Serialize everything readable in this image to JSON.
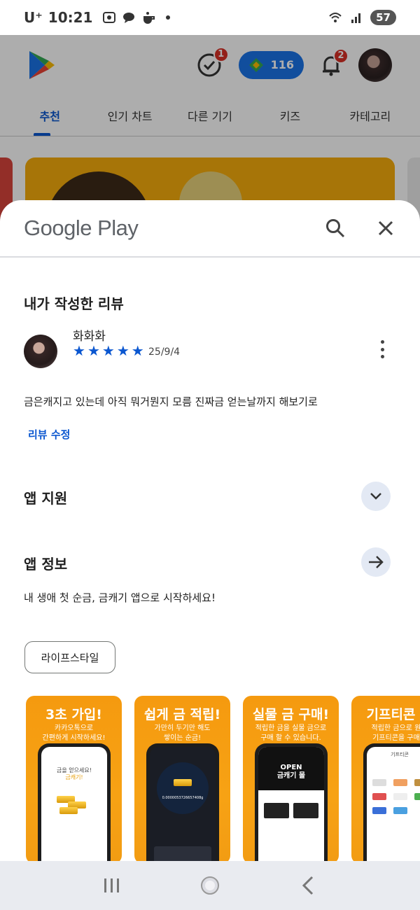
{
  "status_bar": {
    "carrier": "U⁺",
    "time": "10:21",
    "battery": "57",
    "icons": [
      "screenshot-icon",
      "talk-icon",
      "coffee-icon",
      "dot-icon",
      "wifi-icon",
      "signal-icon"
    ]
  },
  "background_app": {
    "badges": {
      "check": "1",
      "notifications": "2"
    },
    "points": "116",
    "tabs": [
      "추천",
      "인기 차트",
      "다른 기기",
      "키즈",
      "카테고리"
    ],
    "active_tab": 0
  },
  "sheet": {
    "logo": "Google Play",
    "reviews": {
      "title": "내가 작성한 리뷰",
      "reviewer": "화화화",
      "rating": 5,
      "stars": [
        "★",
        "★",
        "★",
        "★",
        "★"
      ],
      "date": "25/9/4",
      "text": "금은캐지고 있는데 아직 뭐거뭔지 모름 진짜금 얻는날까지 해보기로",
      "edit_label": "리뷰 수정"
    },
    "support": {
      "title": "앱 지원"
    },
    "about": {
      "title": "앱 정보",
      "description": "내 생애 첫 순금, 금캐기 앱으로 시작하세요!",
      "category": "라이프스타일"
    },
    "screenshots": [
      {
        "title": "3초 가입!",
        "subtitle": [
          "카카오톡으로",
          "간편하게 시작하세요!"
        ],
        "screen_text": [
          "금을 얻으세요!",
          "금캐기!"
        ]
      },
      {
        "title": "쉽게 금 적립!",
        "subtitle": [
          "가만히 두기만 해도",
          "쌓이는 순금!"
        ],
        "screen_text": [
          "0.0000053726657408g"
        ]
      },
      {
        "title": "실물 금 구매!",
        "subtitle": [
          "적립한 금을 실물 금으로",
          "구매 할 수 있습니다."
        ],
        "screen_text": [
          "OPEN",
          "금캐기 몰"
        ]
      },
      {
        "title": "기프티콘 구",
        "subtitle": [
          "적립한 금으로 원하",
          "기프티콘을 구매하"
        ],
        "screen_text": [
          "기프티콘"
        ]
      }
    ]
  },
  "colors": {
    "accent": "#0b57d0",
    "badge": "#d93025",
    "points_pill": "#1a73e8",
    "screenshot_bg": "#f59a0f"
  }
}
